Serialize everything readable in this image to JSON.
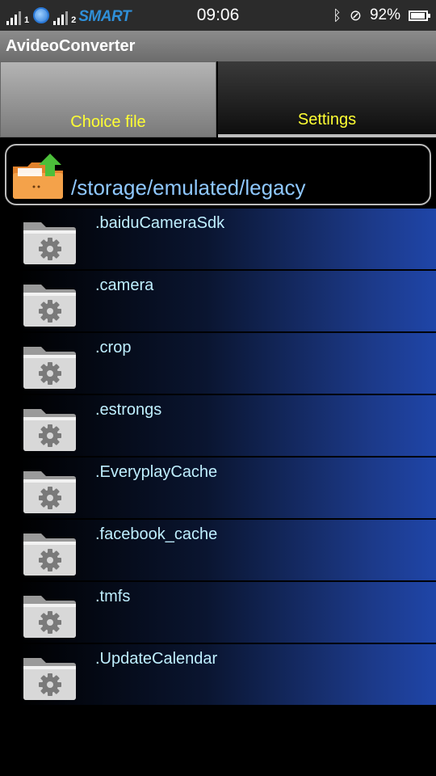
{
  "status_bar": {
    "sim_slot_1": "1",
    "sim_slot_2": "2",
    "carrier": "SMART",
    "time": "09:06",
    "battery_percent": "92%",
    "battery_level": 0.92,
    "icons": [
      "signal-icon",
      "globe-icon",
      "signal-icon",
      "bluetooth-icon",
      "mute-icon",
      "battery-icon"
    ]
  },
  "app": {
    "title": "AvideoConverter"
  },
  "tabs": [
    {
      "label": "Choice file",
      "selected": true
    },
    {
      "label": "Settings",
      "selected": false
    }
  ],
  "path": {
    "current": "/storage/emulated/legacy",
    "icon": "folder-up-icon"
  },
  "files": [
    {
      "name": ".baiduCameraSdk",
      "icon": "folder-gear-icon"
    },
    {
      "name": ".camera",
      "icon": "folder-gear-icon"
    },
    {
      "name": ".crop",
      "icon": "folder-gear-icon"
    },
    {
      "name": ".estrongs",
      "icon": "folder-gear-icon"
    },
    {
      "name": ".EveryplayCache",
      "icon": "folder-gear-icon"
    },
    {
      "name": ".facebook_cache",
      "icon": "folder-gear-icon"
    },
    {
      "name": ".tmfs",
      "icon": "folder-gear-icon"
    },
    {
      "name": ".UpdateCalendar",
      "icon": "folder-gear-icon"
    }
  ],
  "colors": {
    "tab_text": "#ffff33",
    "path_text": "#8fc8ff",
    "file_text": "#bfefff",
    "row_gradient_end": "#1f45a8"
  }
}
